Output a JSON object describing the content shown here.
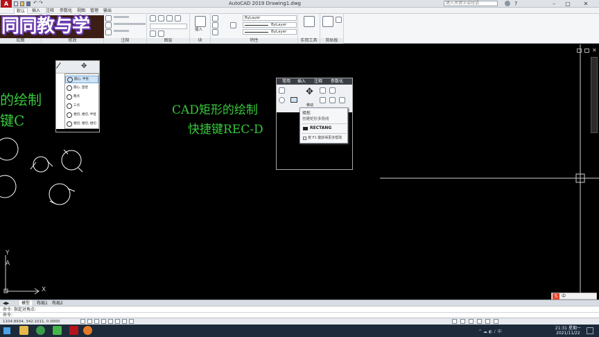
{
  "window": {
    "title": "AutoCAD 2019    Drawing1.dwg",
    "app_logo": "A",
    "search_placeholder": "键入关键字或短语"
  },
  "ribbon_tabs": [
    "默认",
    "插入",
    "注释",
    "参数化",
    "视图",
    "管理",
    "输出"
  ],
  "ribbon": {
    "panel_titles": [
      "绘图",
      "修改",
      "注释",
      "图层",
      "块",
      "特性",
      "实用工具",
      "剪贴板"
    ],
    "insert_label": "插入",
    "bylayer_1": "ByLayer",
    "bylayer_2": "ByLayer",
    "bylayer_3": "ByLayer"
  },
  "banner": {
    "text": "同同教与学"
  },
  "canvas": {
    "left_caption_1": "的绘制",
    "left_caption_2": "键C",
    "right_caption_1": "CAD矩形的绘制",
    "right_caption_2": "快捷键REC-D",
    "ucs_y": "Y",
    "ucs_x": "X"
  },
  "inset_circle": {
    "items": [
      "圆心, 半径",
      "圆心, 直径",
      "两点",
      "三点",
      "相切, 相切, 半径",
      "相切, 相切, 相切"
    ]
  },
  "inset_rect": {
    "tabs": [
      "常用",
      "插入",
      "注释",
      "参数化"
    ],
    "move_label": "移动",
    "tooltip_title": "矩形",
    "tooltip_desc": "创建矩形多段线",
    "command_name": "RECTANG",
    "help_hint": "按 F1 键获得更多帮助"
  },
  "bottom": {
    "layout_tabs": [
      "模型",
      "布局1",
      "布局2"
    ],
    "cmd_history": "命令: 指定对角点:",
    "cmd_prompt": "命令:",
    "coords": "1104.8934, 342.1011, 0.0000"
  },
  "taskbar": {
    "time": "21:31 星期一",
    "date": "2021/11/22"
  },
  "colors": {
    "canvas_bg": "#000000",
    "caption_green": "#37c83b",
    "banner_outline": "#6a3ab0",
    "app_red": "#b5121b"
  }
}
